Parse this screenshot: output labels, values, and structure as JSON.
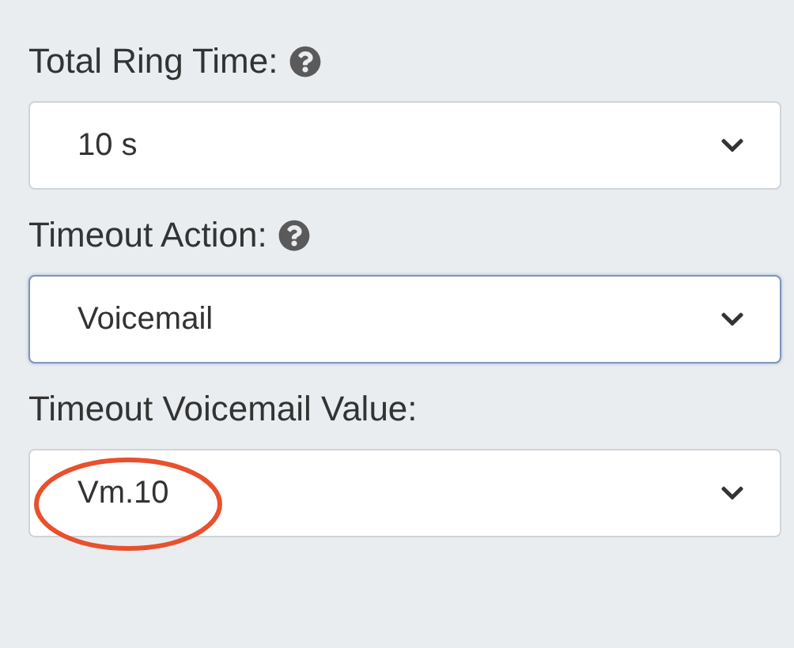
{
  "fields": [
    {
      "label": "Total Ring Time:",
      "help": true,
      "value": "10 s",
      "focused": false,
      "circled": false
    },
    {
      "label": "Timeout Action:",
      "help": true,
      "value": "Voicemail",
      "focused": true,
      "circled": false
    },
    {
      "label": "Timeout Voicemail Value:",
      "help": false,
      "value": "Vm.10",
      "focused": false,
      "circled": true
    }
  ]
}
